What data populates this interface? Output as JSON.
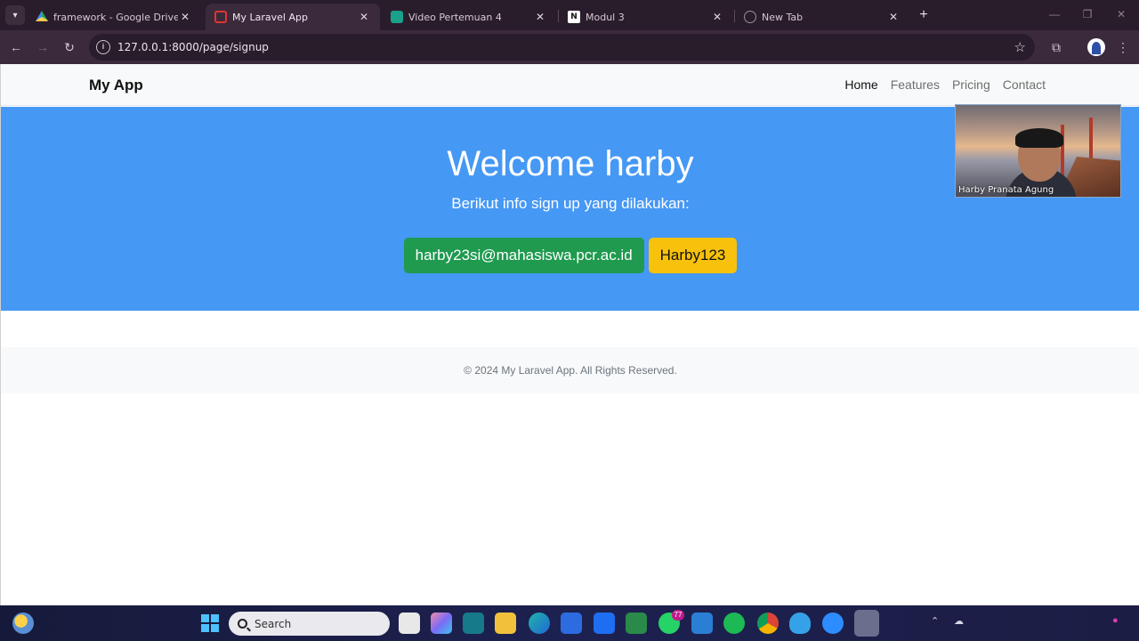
{
  "browser": {
    "tabs": [
      {
        "title": "framework - Google Drive",
        "icon": "google-drive-icon",
        "active": false
      },
      {
        "title": "My Laravel App",
        "icon": "laravel-icon",
        "active": true
      },
      {
        "title": "Video Pertemuan 4",
        "icon": "google-classroom-icon",
        "active": false
      },
      {
        "title": "Modul 3",
        "icon": "notion-icon",
        "active": false
      },
      {
        "title": "New Tab",
        "icon": "globe-icon",
        "active": false
      }
    ],
    "close_glyph": "✕",
    "new_tab_glyph": "+",
    "url": "127.0.0.1:8000/page/signup"
  },
  "app": {
    "brand": "My App",
    "nav": [
      {
        "label": "Home",
        "active": true
      },
      {
        "label": "Features",
        "active": false
      },
      {
        "label": "Pricing",
        "active": false
      },
      {
        "label": "Contact",
        "active": false
      }
    ],
    "hero": {
      "title": "Welcome harby",
      "subtitle": "Berikut info sign up yang dilakukan:",
      "email": "harby23si@mahasiswa.pcr.ac.id",
      "password": "Harby123"
    },
    "footer": "© 2024 My Laravel App. All Rights Reserved.",
    "colors": {
      "hero": "#4598f4",
      "email_badge": "#1f9a4f",
      "password_badge": "#f8c10c"
    }
  },
  "webcam": {
    "name": "Harby Pranata Agung"
  },
  "taskbar": {
    "search_placeholder": "Search",
    "whatsapp_badge": "77"
  }
}
